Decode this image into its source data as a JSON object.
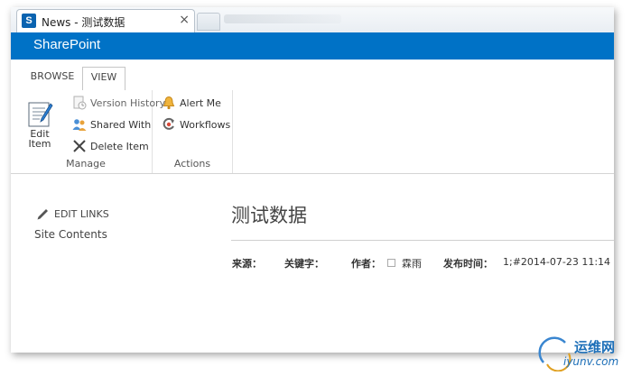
{
  "browser": {
    "tab_title": "News - 测试数据",
    "tab_close": "×",
    "favicon_letter": "S"
  },
  "suitebar": {
    "title": "SharePoint",
    "color": "#0072c6"
  },
  "ribbon": {
    "tabs": [
      {
        "label": "BROWSE",
        "selected": false
      },
      {
        "label": "VIEW",
        "selected": true
      }
    ],
    "groups": {
      "manage": {
        "label": "Manage",
        "edit_item": "Edit Item",
        "version_history": "Version History",
        "shared_with": "Shared With",
        "delete_item": "Delete Item"
      },
      "actions": {
        "label": "Actions",
        "alert_me": "Alert Me",
        "workflows": "Workflows"
      }
    }
  },
  "left_nav": {
    "edit_links": "EDIT LINKS",
    "site_contents": "Site Contents"
  },
  "content": {
    "title": "测试数据",
    "meta": {
      "source_label": "来源：",
      "keywords_label": "关键字：",
      "author_label": "作者：",
      "author_value": "霖雨",
      "published_label": "发布时间：",
      "published_value": "1;#2014-07-23 11:14"
    }
  },
  "watermark": {
    "top": "运维网",
    "bottom": "iyunv.com"
  }
}
